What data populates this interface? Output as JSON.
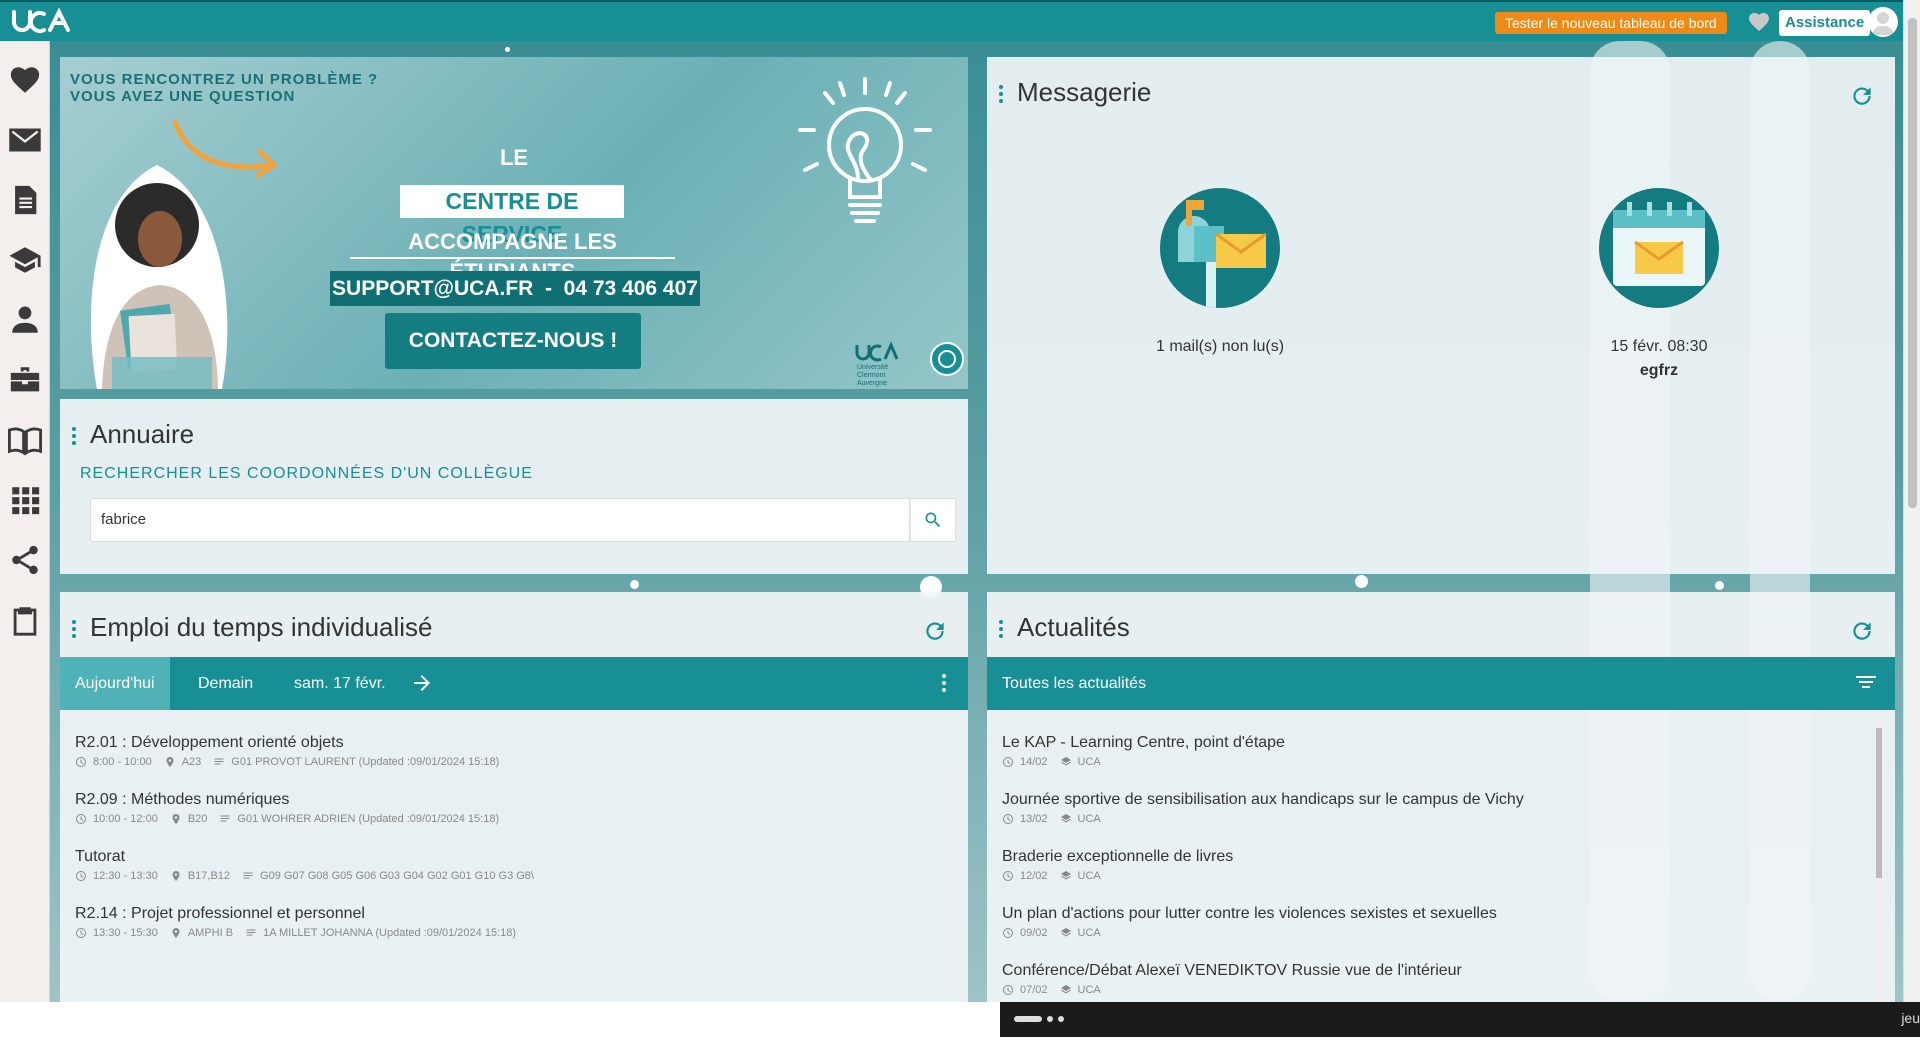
{
  "topbar": {
    "logo_text": "uca",
    "try_label": "Tester le nouveau tableau de bord",
    "assistance_label": "Assistance"
  },
  "sidebar": {
    "items": [
      {
        "icon": "heart-icon"
      },
      {
        "icon": "mail-icon"
      },
      {
        "icon": "document-icon"
      },
      {
        "icon": "graduation-cap-icon"
      },
      {
        "icon": "user-icon"
      },
      {
        "icon": "briefcase-icon"
      },
      {
        "icon": "book-icon"
      },
      {
        "icon": "apps-grid-icon"
      },
      {
        "icon": "share-icon"
      },
      {
        "icon": "clipboard-icon"
      }
    ]
  },
  "banner": {
    "question_1": "VOUS RENCONTREZ UN PROBLÈME ?",
    "question_2": "VOUS AVEZ UNE QUESTION",
    "le": "LE",
    "centre": "CENTRE DE SERVICE",
    "accompagne": "ACCOMPAGNE LES ÉTUDIANTS",
    "support": "SUPPORT@UCA.FR  -  04 73 406 407",
    "contact_button": "CONTACTEZ-NOUS !",
    "logo_line1": "Université",
    "logo_line2": "Clermont",
    "logo_line3": "Auvergne"
  },
  "annuaire": {
    "title": "Annuaire",
    "subtitle": "RECHERCHER LES COORDONNÉES D'UN COLLÈGUE",
    "search_value": "fabrice"
  },
  "messagerie": {
    "title": "Messagerie",
    "mail_count": "1 mail(s) non lu(s)",
    "event_date": "15 févr. 08:30",
    "event_name": "egfrz"
  },
  "emploi": {
    "title": "Emploi du temps individualisé",
    "tabs": [
      "Aujourd'hui",
      "Demain",
      "sam. 17 févr."
    ],
    "events": [
      {
        "title": "R2.01 : Développement orienté objets",
        "time": "8:00 - 10:00",
        "room": "A23",
        "info": "G01 PROVOT LAURENT (Updated :09/01/2024 15:18)"
      },
      {
        "title": "R2.09 : Méthodes numériques",
        "time": "10:00 - 12:00",
        "room": "B20",
        "info": "G01 WOHRER ADRIEN (Updated :09/01/2024 15:18)"
      },
      {
        "title": "Tutorat",
        "time": "12:30 - 13:30",
        "room": "B17,B12",
        "info": "G09 G07 G08 G05 G06 G03 G04 G02 G01 G10 G3 G8\\"
      },
      {
        "title": "R2.14 : Projet professionnel et personnel",
        "time": "13:30 - 15:30",
        "room": "AMPHI B",
        "info": "1A MILLET JOHANNA (Updated :09/01/2024 15:18)"
      }
    ]
  },
  "actualites": {
    "title": "Actualités",
    "filter_label": "Toutes les actualités",
    "items": [
      {
        "title": "Le KAP - Learning Centre, point d'étape",
        "date": "14/02",
        "source": "UCA"
      },
      {
        "title": "Journée sportive de sensibilisation aux handicaps sur le campus de Vichy",
        "date": "13/02",
        "source": "UCA"
      },
      {
        "title": "Braderie exceptionnelle de livres",
        "date": "12/02",
        "source": "UCA"
      },
      {
        "title": "Un plan d'actions pour lutter contre les violences sexistes et sexuelles",
        "date": "09/02",
        "source": "UCA"
      },
      {
        "title": "Conférence/Débat Alexeï VENEDIKTOV Russie vue de l'intérieur",
        "date": "07/02",
        "source": "UCA"
      }
    ]
  },
  "bottom": {
    "right_text": "jeu"
  },
  "colors": {
    "brand": "#178f94",
    "accent": "#ee8a18"
  }
}
